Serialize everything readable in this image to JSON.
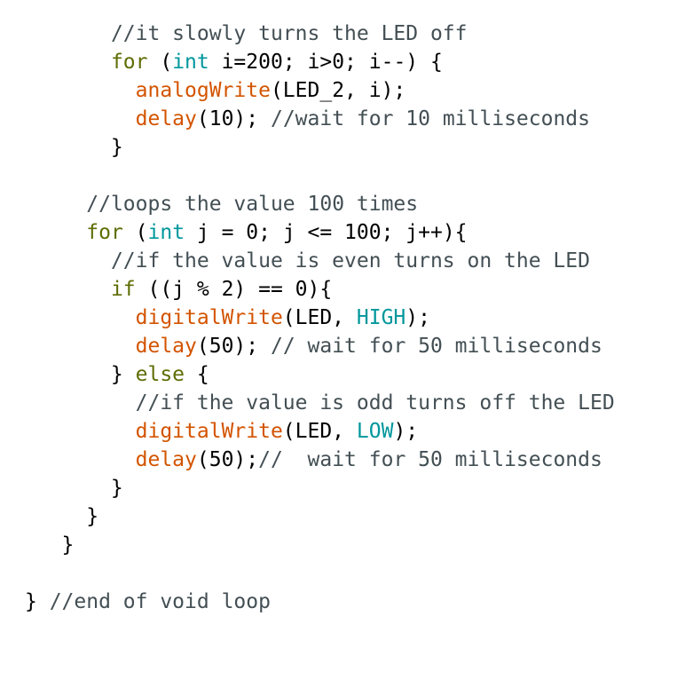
{
  "colors": {
    "kw": "#5e6d03",
    "type": "#00979c",
    "fn": "#d35400",
    "cm": "#434f54",
    "p": "#000000"
  },
  "code_lines": [
    [
      {
        "t": "       "
      },
      {
        "t": "//it slowly turns the LED off",
        "c": "cm"
      }
    ],
    [
      {
        "t": "       "
      },
      {
        "t": "for",
        "c": "kw"
      },
      {
        "t": " ("
      },
      {
        "t": "int",
        "c": "type"
      },
      {
        "t": " i=200; i>0; i--) {"
      }
    ],
    [
      {
        "t": "         "
      },
      {
        "t": "analogWrite",
        "c": "fn"
      },
      {
        "t": "(LED_2, i);"
      }
    ],
    [
      {
        "t": "         "
      },
      {
        "t": "delay",
        "c": "fn"
      },
      {
        "t": "(10); "
      },
      {
        "t": "//wait for 10 milliseconds",
        "c": "cm"
      }
    ],
    [
      {
        "t": "       }"
      }
    ],
    [],
    [
      {
        "t": "     "
      },
      {
        "t": "//loops the value 100 times",
        "c": "cm"
      }
    ],
    [
      {
        "t": "     "
      },
      {
        "t": "for",
        "c": "kw"
      },
      {
        "t": " ("
      },
      {
        "t": "int",
        "c": "type"
      },
      {
        "t": " j = 0; j <= 100; j++){"
      }
    ],
    [
      {
        "t": "       "
      },
      {
        "t": "//if the value is even turns on the LED",
        "c": "cm"
      }
    ],
    [
      {
        "t": "       "
      },
      {
        "t": "if",
        "c": "kw"
      },
      {
        "t": " ((j % 2) == 0){"
      }
    ],
    [
      {
        "t": "         "
      },
      {
        "t": "digitalWrite",
        "c": "fn"
      },
      {
        "t": "(LED, "
      },
      {
        "t": "HIGH",
        "c": "type"
      },
      {
        "t": ");"
      }
    ],
    [
      {
        "t": "         "
      },
      {
        "t": "delay",
        "c": "fn"
      },
      {
        "t": "(50); "
      },
      {
        "t": "// wait for 50 milliseconds",
        "c": "cm"
      }
    ],
    [
      {
        "t": "       } "
      },
      {
        "t": "else",
        "c": "kw"
      },
      {
        "t": " {"
      }
    ],
    [
      {
        "t": "         "
      },
      {
        "t": "//if the value is odd turns off the LED",
        "c": "cm"
      }
    ],
    [
      {
        "t": "         "
      },
      {
        "t": "digitalWrite",
        "c": "fn"
      },
      {
        "t": "(LED, "
      },
      {
        "t": "LOW",
        "c": "type"
      },
      {
        "t": ");"
      }
    ],
    [
      {
        "t": "         "
      },
      {
        "t": "delay",
        "c": "fn"
      },
      {
        "t": "(50);"
      },
      {
        "t": "//  wait for 50 milliseconds",
        "c": "cm"
      }
    ],
    [
      {
        "t": "       }"
      }
    ],
    [
      {
        "t": "     }"
      }
    ],
    [
      {
        "t": "   }"
      }
    ],
    [],
    [
      {
        "t": "} "
      },
      {
        "t": "//end of void loop",
        "c": "cm"
      }
    ]
  ]
}
